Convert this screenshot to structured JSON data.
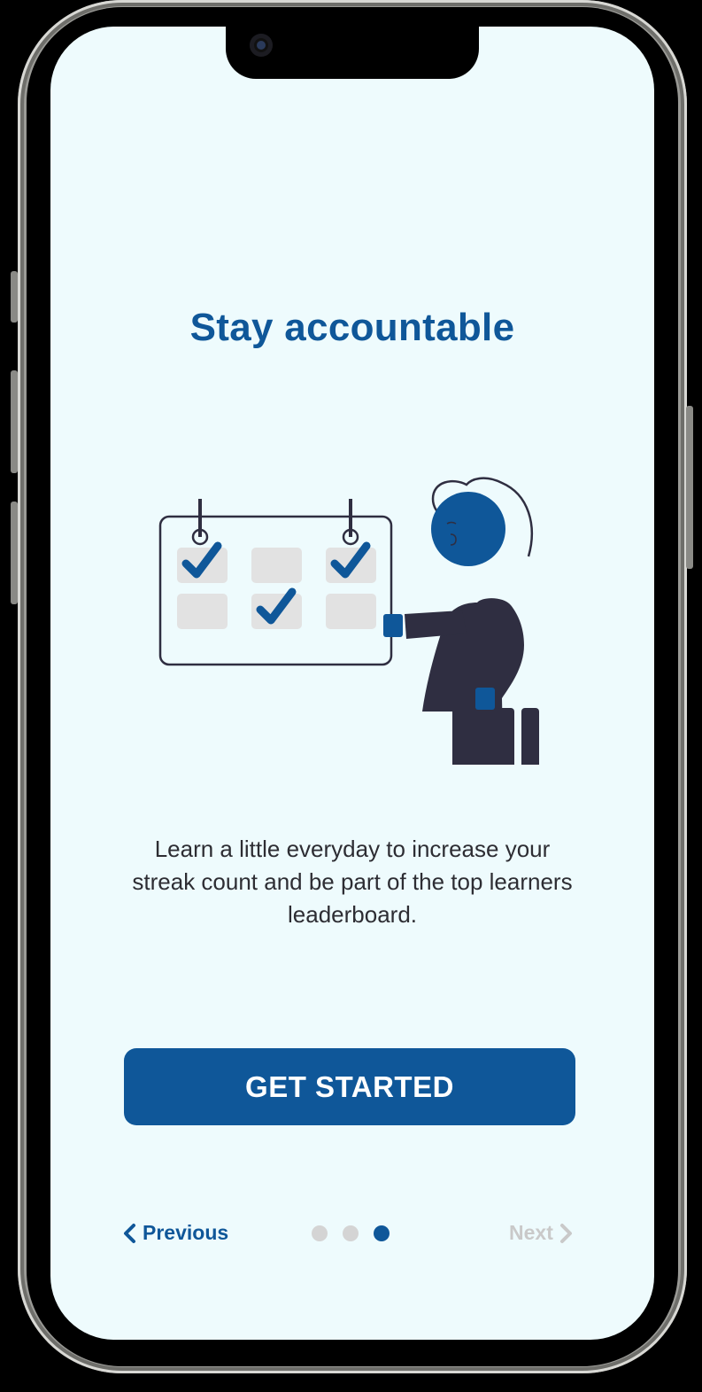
{
  "onboarding": {
    "title": "Stay accountable",
    "description": "Learn a little everyday to increase your streak count and be part of the top learners leaderboard.",
    "cta_label": "GET STARTED",
    "previous_label": "Previous",
    "next_label": "Next",
    "page_indicator": {
      "total": 3,
      "current": 3
    }
  },
  "colors": {
    "brand": "#0f5799",
    "background": "#eefbfd",
    "text": "#2d2d33",
    "disabled": "#c9c9c9",
    "dot_inactive": "#d4d4d4"
  },
  "illustration": {
    "icon": "calendar-checkmarks-person-illustration",
    "calendar_cells": [
      true,
      false,
      true,
      false,
      true,
      false
    ]
  }
}
